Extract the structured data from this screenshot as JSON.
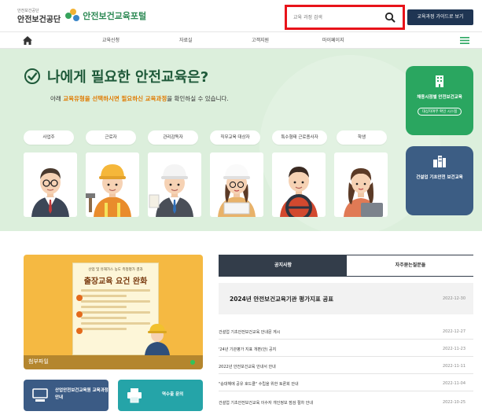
{
  "header": {
    "org_small": "안전보건공단",
    "org_name": "안전보건공단",
    "portal_name": "안전보건교육포털",
    "search_placeholder": "교육 과정 검색",
    "guide_button": "교육과정 가이드로 보기"
  },
  "nav": {
    "items": [
      "교육신청",
      "자료실",
      "고객지원",
      "마이페이지"
    ]
  },
  "hero": {
    "title": "나에게 필요한 안전교육은?",
    "subtitle_pre": "아래 ",
    "subtitle_highlight": "교육유형을 선택하시면 필요하신 교육과정",
    "subtitle_post": "을 확인하실 수 있습니다.",
    "types": [
      "사업주",
      "근로자",
      "관리감독자",
      "직무교육 대상자",
      "특수형태 근로종사자",
      "학생"
    ],
    "side_cards": [
      {
        "label": "채용시점별 안전보건교육",
        "pill": "대상자여부 확인 시스템"
      },
      {
        "label": "건설업 기초안전 보건교육"
      }
    ]
  },
  "banner": {
    "poster_top": "산업 및 유해가스 농도 측정평가 결과",
    "poster_title": "출장교육 요건 완화",
    "attach_label": "첨부파일"
  },
  "quick_links": [
    {
      "label": "산업안전보건교육원 교육과정안내"
    },
    {
      "label": "역수출 문의"
    }
  ],
  "tabs": [
    "공지사항",
    "자주묻는질문들"
  ],
  "notices": {
    "featured": {
      "title": "2024년 안전보건교육기관 평가지표 공표",
      "date": "2022-12-30"
    },
    "items": [
      {
        "title": "건설업 기초안전보건교육 안내문 게시",
        "date": "2022-12-27"
      },
      {
        "title": "'24년 기관평가 지표 개편(안) 공지",
        "date": "2022-11-23"
      },
      {
        "title": "2022년 안전보건교육 안내서 안내",
        "date": "2022-11-11"
      },
      {
        "title": "\"승대해에 공유 호드클\" 수립을 위한 토론회 안내",
        "date": "2022-11-04"
      },
      {
        "title": "건설업 기초안전보건교육 이수자 개인정보 점검 절차 안내",
        "date": "2022-10-25"
      }
    ]
  },
  "colors": {
    "search_highlight": "#e8131a",
    "hero_bg": "#dcefdc",
    "accent_green": "#2aa660",
    "navy": "#3c5d84",
    "banner_yellow": "#f5b942"
  }
}
